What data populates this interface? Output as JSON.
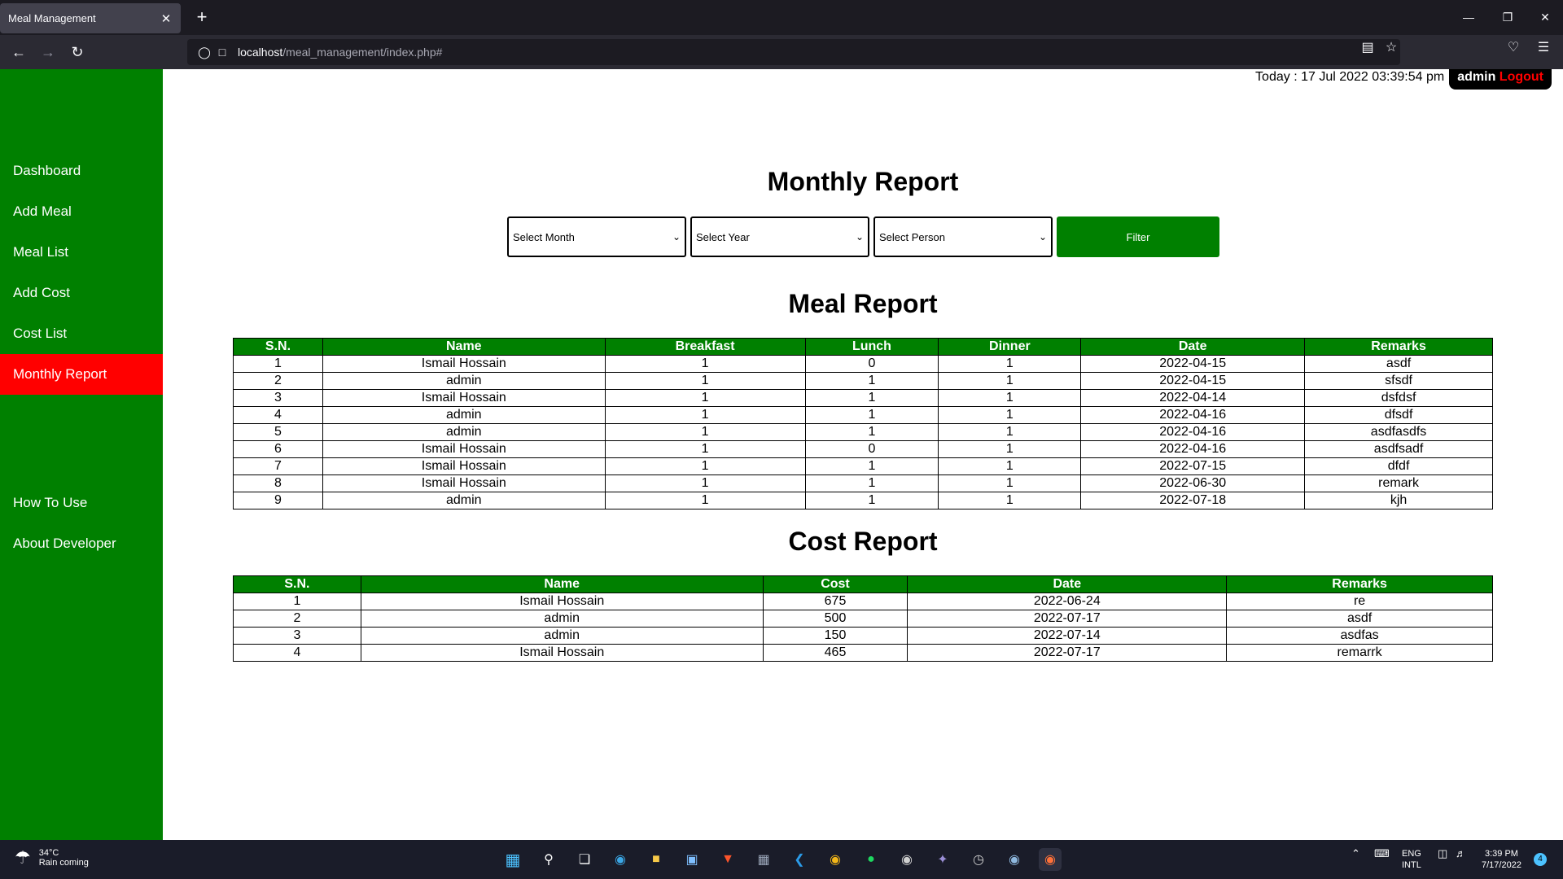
{
  "browser": {
    "tab_title": "Meal Management",
    "tab_close": "✕",
    "new_tab": "+",
    "url_host": "localhost",
    "url_path": "/meal_management/index.php#"
  },
  "sidebar": {
    "items": [
      {
        "label": "Dashboard"
      },
      {
        "label": "Add Meal"
      },
      {
        "label": "Meal List"
      },
      {
        "label": "Add Cost"
      },
      {
        "label": "Cost List"
      },
      {
        "label": "Monthly Report"
      },
      {
        "label": "How To Use"
      },
      {
        "label": "About Developer"
      }
    ],
    "active_item": "Monthly Report"
  },
  "header": {
    "today": "Today : 17 Jul 2022 03:39:54 pm",
    "user": "admin",
    "logout": "Logout"
  },
  "report": {
    "title": "Monthly Report",
    "month_select": "Select Month",
    "year_select": "Select Year",
    "person_select": "Select Person",
    "filter_button": "Filter"
  },
  "meal_report": {
    "title": "Meal Report",
    "headers": [
      "S.N.",
      "Name",
      "Breakfast",
      "Lunch",
      "Dinner",
      "Date",
      "Remarks"
    ],
    "rows": [
      [
        "1",
        "Ismail Hossain",
        "1",
        "0",
        "1",
        "2022-04-15",
        "asdf"
      ],
      [
        "2",
        "admin",
        "1",
        "1",
        "1",
        "2022-04-15",
        "sfsdf"
      ],
      [
        "3",
        "Ismail Hossain",
        "1",
        "1",
        "1",
        "2022-04-14",
        "dsfdsf"
      ],
      [
        "4",
        "admin",
        "1",
        "1",
        "1",
        "2022-04-16",
        "dfsdf"
      ],
      [
        "5",
        "admin",
        "1",
        "1",
        "1",
        "2022-04-16",
        "asdfasdfs"
      ],
      [
        "6",
        "Ismail Hossain",
        "1",
        "0",
        "1",
        "2022-04-16",
        "asdfsadf"
      ],
      [
        "7",
        "Ismail Hossain",
        "1",
        "1",
        "1",
        "2022-07-15",
        "dfdf"
      ],
      [
        "8",
        "Ismail Hossain",
        "1",
        "1",
        "1",
        "2022-06-30",
        "remark"
      ],
      [
        "9",
        "admin",
        "1",
        "1",
        "1",
        "2022-07-18",
        "kjh"
      ]
    ]
  },
  "cost_report": {
    "title": "Cost Report",
    "headers": [
      "S.N.",
      "Name",
      "Cost",
      "Date",
      "Remarks"
    ],
    "rows": [
      [
        "1",
        "Ismail Hossain",
        "675",
        "2022-06-24",
        "re"
      ],
      [
        "2",
        "admin",
        "500",
        "2022-07-17",
        "asdf"
      ],
      [
        "3",
        "admin",
        "150",
        "2022-07-14",
        "asdfas"
      ],
      [
        "4",
        "Ismail Hossain",
        "465",
        "2022-07-17",
        "remarrk"
      ]
    ]
  },
  "taskbar": {
    "temperature": "34°C",
    "weather": "Rain coming",
    "lang_top": "ENG",
    "lang_bottom": "INTL",
    "time": "3:39 PM",
    "date": "7/17/2022",
    "notifications": "4"
  },
  "colors": {
    "sidebar": "#008000",
    "active": "#ff0000",
    "table_header": "#008000"
  }
}
